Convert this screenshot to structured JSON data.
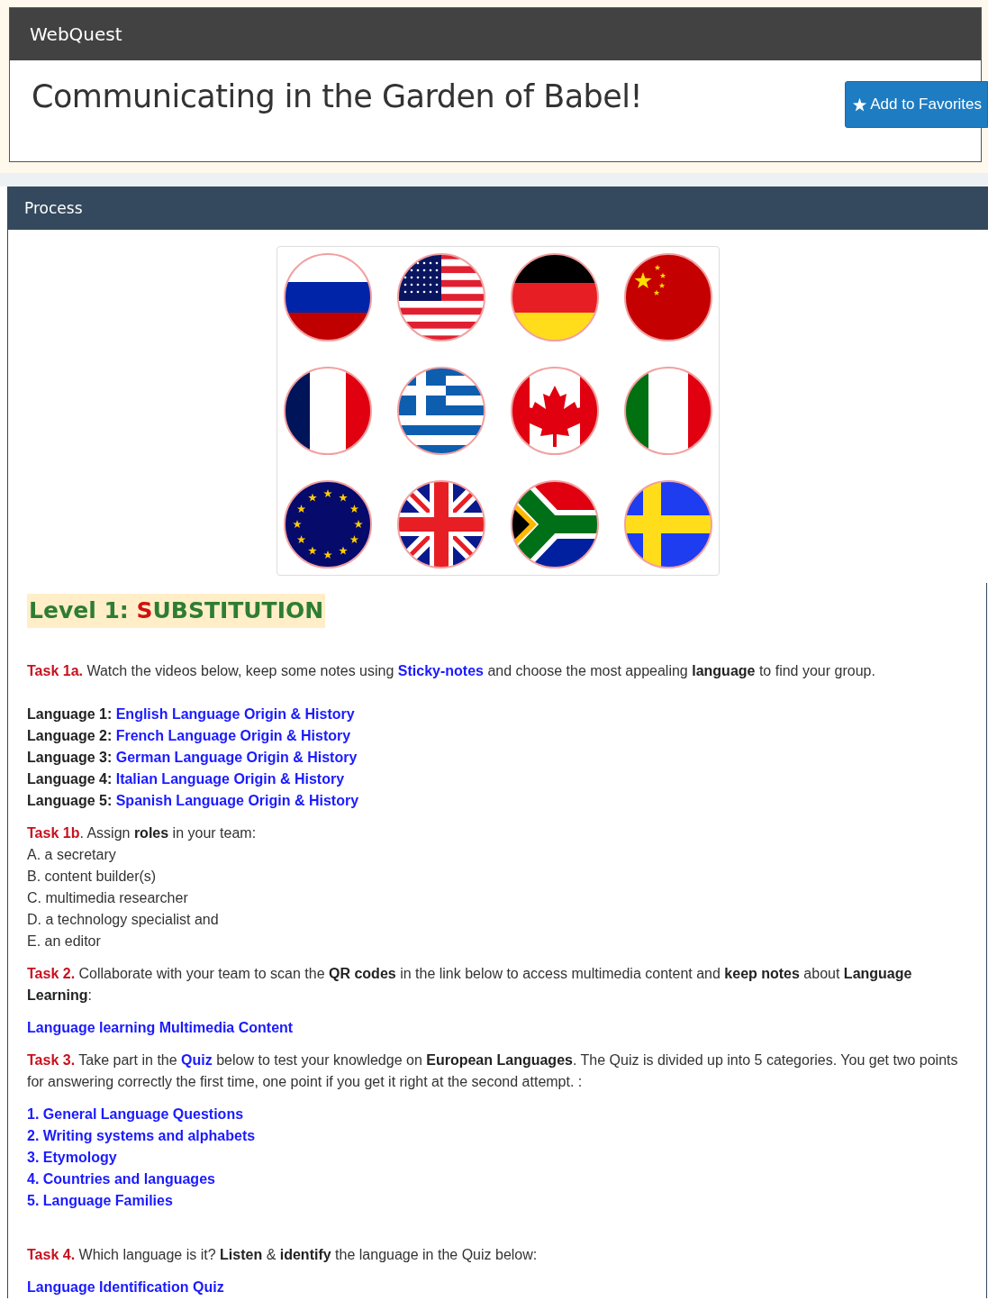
{
  "header": {
    "brand": "WebQuest",
    "title": "Communicating in the Garden of Babel!",
    "favorite_button": "Add to Favorites"
  },
  "panel": {
    "title": "Process"
  },
  "content": [
    {
      "kind": "heading",
      "parts": [
        {
          "kind": "text",
          "text": "Level 1: "
        },
        {
          "kind": "accent",
          "text": "S"
        },
        {
          "kind": "text",
          "text": "UBSTITUTION"
        }
      ]
    },
    {
      "kind": "paragraph",
      "parts": [
        {
          "kind": "label",
          "text": "Task 1a."
        },
        {
          "kind": "text",
          "text": " Watch the videos below, keep some notes using "
        },
        {
          "kind": "link",
          "text": "Sticky-notes"
        },
        {
          "kind": "text",
          "text": " and choose the most appealing "
        },
        {
          "kind": "bold",
          "text": "language"
        },
        {
          "kind": "text",
          "text": " to find your group."
        }
      ]
    },
    {
      "kind": "labeled_links",
      "rows": [
        {
          "label": "Language 1: ",
          "link": "English Language Origin & History"
        },
        {
          "label": "Language 2:",
          "link": "French Language Origin & History"
        },
        {
          "label": "Language 3:",
          "link": "German Language Origin & History"
        },
        {
          "label": "Language 4:",
          "link": "Italian Language Origin & History"
        },
        {
          "label": "Language 5:",
          "link": "Spanish Language Origin & History"
        }
      ]
    },
    {
      "kind": "paragraph",
      "parts": [
        {
          "kind": "label",
          "text": "Task 1b"
        },
        {
          "kind": "text",
          "text": ". Assign "
        },
        {
          "kind": "bold",
          "text": "roles"
        },
        {
          "kind": "text",
          "text": " in your team:"
        }
      ]
    },
    {
      "kind": "lines",
      "lines": [
        "A. a secretary",
        "B. content builder(s)",
        "C. multimedia researcher",
        "D. a technology specialist and",
        "E. an editor"
      ]
    },
    {
      "kind": "paragraph",
      "parts": [
        {
          "kind": "label",
          "text": "Task 2."
        },
        {
          "kind": "text",
          "text": " Collaborate with your team to scan the "
        },
        {
          "kind": "bold",
          "text": "QR codes"
        },
        {
          "kind": "text",
          "text": " in the link below to access multimedia content and "
        },
        {
          "kind": "bold",
          "text": "keep notes"
        },
        {
          "kind": "text",
          "text": " about "
        },
        {
          "kind": "bold",
          "text": "Language Learning"
        },
        {
          "kind": "text",
          "text": ":"
        }
      ]
    },
    {
      "kind": "paragraph",
      "parts": [
        {
          "kind": "link",
          "text": "Language learning Multimedia Content"
        }
      ]
    },
    {
      "kind": "paragraph",
      "parts": [
        {
          "kind": "label",
          "text": "Task 3."
        },
        {
          "kind": "text",
          "text": " Take part in the "
        },
        {
          "kind": "link",
          "text": "Quiz"
        },
        {
          "kind": "text",
          "text": " below to test your knowledge on "
        },
        {
          "kind": "bold",
          "text": "European Languages"
        },
        {
          "kind": "text",
          "text": ". The Quiz is divided up into 5 categories. You get two points for answering correctly the first time, one point if you get it right at the second attempt. :"
        }
      ]
    },
    {
      "kind": "links",
      "links": [
        "1. General Language Questions",
        "2. Writing systems and alphabets",
        "3. Etymology",
        "4. Countries and languages",
        "5. Language Families"
      ]
    },
    {
      "kind": "paragraph",
      "parts": [
        {
          "kind": "label",
          "text": "Task 4."
        },
        {
          "kind": "text",
          "text": " Which language is it? "
        },
        {
          "kind": "bold",
          "text": "Listen"
        },
        {
          "kind": "text",
          "text": " & "
        },
        {
          "kind": "bold",
          "text": "identify"
        },
        {
          "kind": "text",
          "text": " the language in the Quiz below:"
        }
      ]
    },
    {
      "kind": "paragraph",
      "parts": [
        {
          "kind": "link",
          "text": "Language Identification Quiz"
        }
      ]
    }
  ]
}
